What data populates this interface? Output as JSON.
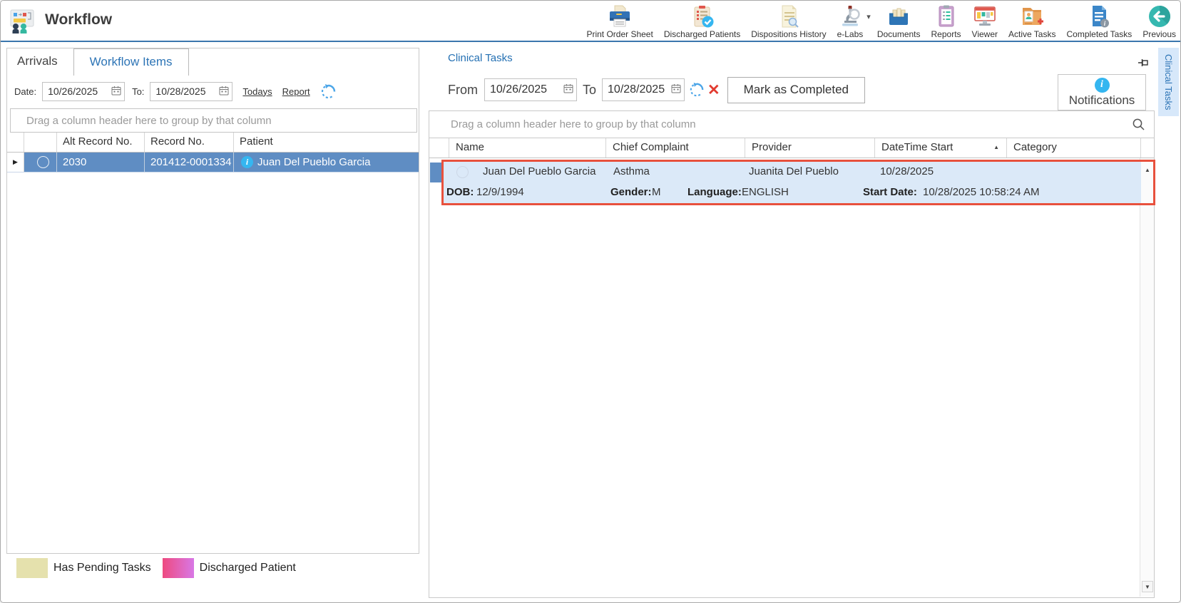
{
  "window": {
    "title": "Workflow"
  },
  "icons": {
    "dropdown_caret": "▾",
    "sort_asc": "▲",
    "scroll_up": "▲",
    "scroll_down": "▼",
    "row_indicator": "▶",
    "clear_x": "✕",
    "info_glyph": "i"
  },
  "toolbar": {
    "items": [
      {
        "icon": "printer-icon",
        "label": "Print Order Sheet"
      },
      {
        "icon": "clipboard-check-icon",
        "label": "Discharged Patients"
      },
      {
        "icon": "document-search-icon",
        "label": "Dispositions History"
      },
      {
        "icon": "microscope-icon",
        "label": "e-Labs",
        "has_dropdown": true
      },
      {
        "icon": "archive-drawer-icon",
        "label": "Documents"
      },
      {
        "icon": "report-clipboard-icon",
        "label": "Reports"
      },
      {
        "icon": "monitor-icon",
        "label": "Viewer"
      },
      {
        "icon": "patient-folder-icon",
        "label": "Active Tasks"
      },
      {
        "icon": "document-info-icon",
        "label": "Completed Tasks"
      },
      {
        "icon": "back-arrow-icon",
        "label": "Previous"
      }
    ]
  },
  "left_panel": {
    "tabs": [
      {
        "label": "Arrivals",
        "selected": false
      },
      {
        "label": "Workflow Items",
        "selected": true
      }
    ],
    "filter": {
      "date_label": "Date:",
      "from_value": "10/26/2025",
      "to_label": "To:",
      "to_value": "10/28/2025",
      "todays_link": "Todays",
      "report_link": "Report"
    },
    "grid": {
      "group_hint": "Drag a column header here to group by that column",
      "columns": [
        "Alt Record No.",
        "Record No.",
        "Patient"
      ],
      "rows": [
        {
          "alt_record_no": "2030",
          "record_no": "201412-0001334",
          "patient": "Juan Del Pueblo Garcia",
          "selected": true
        }
      ]
    },
    "legend": [
      {
        "label": "Has Pending Tasks",
        "color": "#e5e1ad"
      },
      {
        "label": "Discharged Patient",
        "color_start": "#ee4a80",
        "color_end": "#d878e6"
      }
    ]
  },
  "right_panel": {
    "title": "Clinical Tasks",
    "filter": {
      "from_label": "From",
      "from_value": "10/26/2025",
      "to_label": "To",
      "to_value": "10/28/2025",
      "mark_completed_label": "Mark as Completed"
    },
    "notifications_label": "Notifications",
    "grid": {
      "group_hint": "Drag a column header here to group by that column",
      "columns": [
        "Name",
        "Chief Complaint",
        "Provider",
        "DateTime Start",
        "Category"
      ],
      "sorted_column": "DateTime Start",
      "sort_direction": "ascending",
      "rows": [
        {
          "name": "Juan Del Pueblo Garcia",
          "chief_complaint": "Asthma",
          "provider": "Juanita Del Pueblo",
          "datetime_start": "10/28/2025",
          "category": "",
          "highlighted": true,
          "details": {
            "dob_label": "DOB:",
            "dob_value": "12/9/1994",
            "gender_label": "Gender:",
            "gender_value": "M",
            "language_label": "Language:",
            "language_value": "ENGLISH",
            "start_date_label": "Start Date:",
            "start_date_value": "10/28/2025 10:58:24 AM"
          }
        }
      ]
    }
  },
  "side_tab": {
    "label": "Clinical Tasks"
  },
  "colors": {
    "selection_blue": "#5f8dc3",
    "highlight_border_red": "#e8513d",
    "highlight_row_bg": "#dbe9f8",
    "link_blue": "#2e75b6",
    "title_underline_blue": "#3b76ad",
    "info_icon_blue": "#35b6f0",
    "pending_legend": "#e5e1ad"
  }
}
